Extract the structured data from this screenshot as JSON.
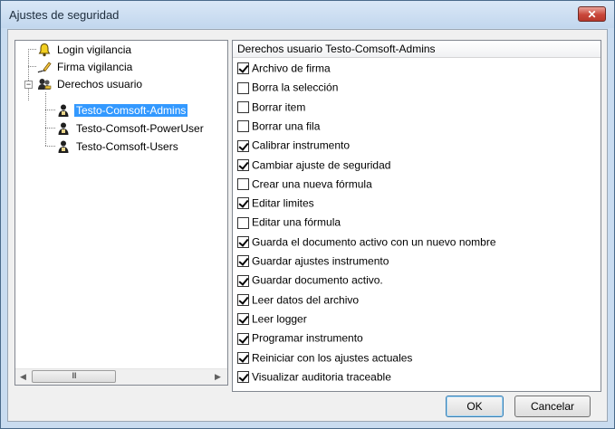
{
  "window": {
    "title": "Ajustes de seguridad",
    "close_glyph": "✕"
  },
  "tree": {
    "items": [
      {
        "label": "Login vigilancia",
        "icon": "bell-icon"
      },
      {
        "label": "Firma vigilancia",
        "icon": "signature-pen-icon"
      },
      {
        "label": "Derechos usuario",
        "icon": "users-key-icon",
        "expander": "−"
      },
      {
        "label": "Testo-Comsoft-Admins",
        "icon": "user-group-icon",
        "selected": true
      },
      {
        "label": "Testo-Comsoft-PowerUser",
        "icon": "user-group-icon"
      },
      {
        "label": "Testo-Comsoft-Users",
        "icon": "user-group-icon"
      }
    ],
    "scroll_left": "◀",
    "scroll_right": "▶",
    "scroll_thumb_grip": "III"
  },
  "permissions": {
    "header": "Derechos usuario Testo-Comsoft-Admins",
    "items": [
      {
        "label": "Archivo de firma",
        "checked": true
      },
      {
        "label": "Borra la selección",
        "checked": false
      },
      {
        "label": "Borrar item",
        "checked": false
      },
      {
        "label": "Borrar una fila",
        "checked": false
      },
      {
        "label": "Calibrar instrumento",
        "checked": true
      },
      {
        "label": "Cambiar ajuste de seguridad",
        "checked": true
      },
      {
        "label": "Crear una nueva fórmula",
        "checked": false
      },
      {
        "label": "Editar limites",
        "checked": true
      },
      {
        "label": "Editar una fórmula",
        "checked": false
      },
      {
        "label": "Guarda el documento activo con un nuevo nombre",
        "checked": true
      },
      {
        "label": "Guardar ajustes instrumento",
        "checked": true
      },
      {
        "label": "Guardar documento activo.",
        "checked": true
      },
      {
        "label": "Leer datos del archivo",
        "checked": true
      },
      {
        "label": "Leer logger",
        "checked": true
      },
      {
        "label": "Programar instrumento",
        "checked": true
      },
      {
        "label": "Reiniciar con los ajustes actuales",
        "checked": true
      },
      {
        "label": "Visualizar auditoria traceable",
        "checked": true
      }
    ]
  },
  "buttons": {
    "ok": "OK",
    "cancel": "Cancelar"
  }
}
